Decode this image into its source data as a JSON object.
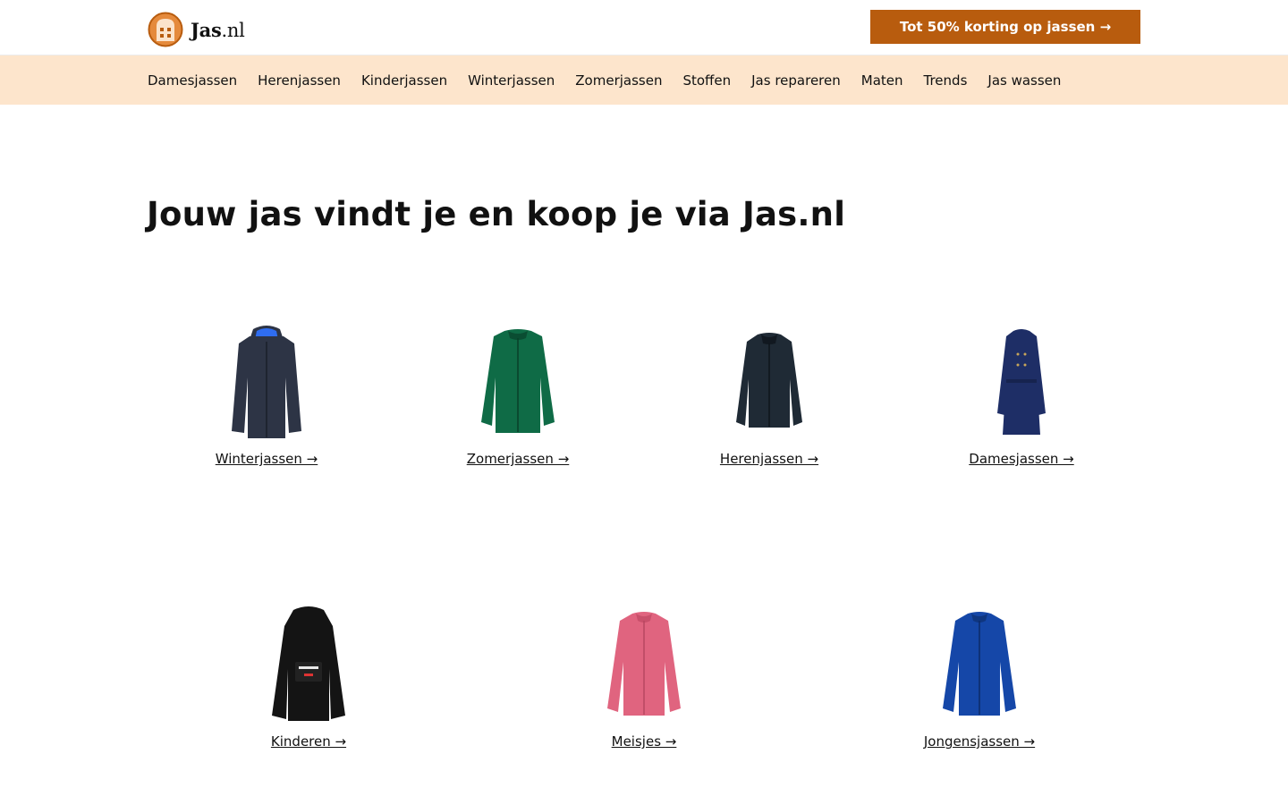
{
  "brand": {
    "name_bold": "Jas",
    "name_suffix": ".nl",
    "accent": "#b85c0e",
    "nav_bg": "#fde5cc"
  },
  "promo": {
    "label": "Tot 50% korting op jassen →"
  },
  "nav": [
    "Damesjassen",
    "Herenjassen",
    "Kinderjassen",
    "Winterjassen",
    "Zomerjassen",
    "Stoffen",
    "Jas repareren",
    "Maten",
    "Trends",
    "Jas wassen"
  ],
  "page_title": "Jouw jas vindt je en koop je via Jas.nl",
  "categories": [
    {
      "label": "Winterjassen →",
      "icon": "parka-jacket-navy-icon",
      "color": "#2d3445"
    },
    {
      "label": "Zomerjassen →",
      "icon": "bomber-jacket-green-icon",
      "color": "#0f6b46"
    },
    {
      "label": "Herenjassen →",
      "icon": "jacket-dark-navy-icon",
      "color": "#1f2a35"
    },
    {
      "label": "Damesjassen →",
      "icon": "trench-coat-blue-icon",
      "color": "#1e2e66"
    },
    {
      "label": "Kinderen →",
      "icon": "anorak-black-icon",
      "color": "#141414"
    },
    {
      "label": "Meisjes →",
      "icon": "bomber-jacket-pink-icon",
      "color": "#e0647f"
    },
    {
      "label": "Jongensjassen →",
      "icon": "bomber-jacket-blue-icon",
      "color": "#1547a8"
    }
  ]
}
